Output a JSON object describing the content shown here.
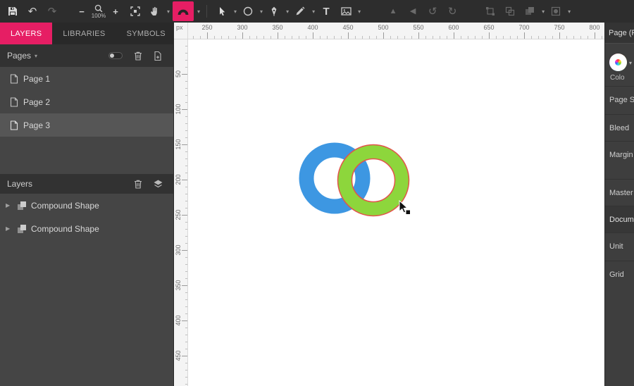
{
  "app": {
    "accent": "#e61e64"
  },
  "toolbar": {
    "zoom_value": "100%",
    "text_tool_glyph": "T"
  },
  "sidebar": {
    "tabs": [
      {
        "label": "LAYERS"
      },
      {
        "label": "LIBRARIES"
      },
      {
        "label": "SYMBOLS"
      }
    ],
    "pages": {
      "header": "Pages",
      "items": [
        {
          "label": "Page 1",
          "selected": false
        },
        {
          "label": "Page 2",
          "selected": false
        },
        {
          "label": "Page 3",
          "selected": true
        }
      ]
    },
    "layers": {
      "header": "Layers",
      "items": [
        {
          "label": "Compound Shape"
        },
        {
          "label": "Compound Shape"
        }
      ]
    }
  },
  "rulers": {
    "unit": "px",
    "horizontal": [
      "250",
      "300",
      "350",
      "400",
      "450",
      "500",
      "550",
      "600",
      "650",
      "700",
      "750",
      "800"
    ],
    "vertical": [
      "50",
      "100",
      "150",
      "200",
      "250",
      "300",
      "350",
      "400",
      "450"
    ]
  },
  "canvas": {
    "shapes": [
      {
        "name": "blue-ring",
        "fill": "#3d97e2"
      },
      {
        "name": "green-ring",
        "fill": "#8dd63c",
        "stroke": "#e2544b"
      }
    ]
  },
  "right_panel": {
    "title": "Page (Pa",
    "color_label": "Colo",
    "items": [
      {
        "label": "Page Siz"
      },
      {
        "label": "Bleed"
      },
      {
        "label": "Margin"
      },
      {
        "label": "Master"
      },
      {
        "label": "Docume"
      },
      {
        "label": "Unit"
      },
      {
        "label": "Grid"
      }
    ]
  }
}
